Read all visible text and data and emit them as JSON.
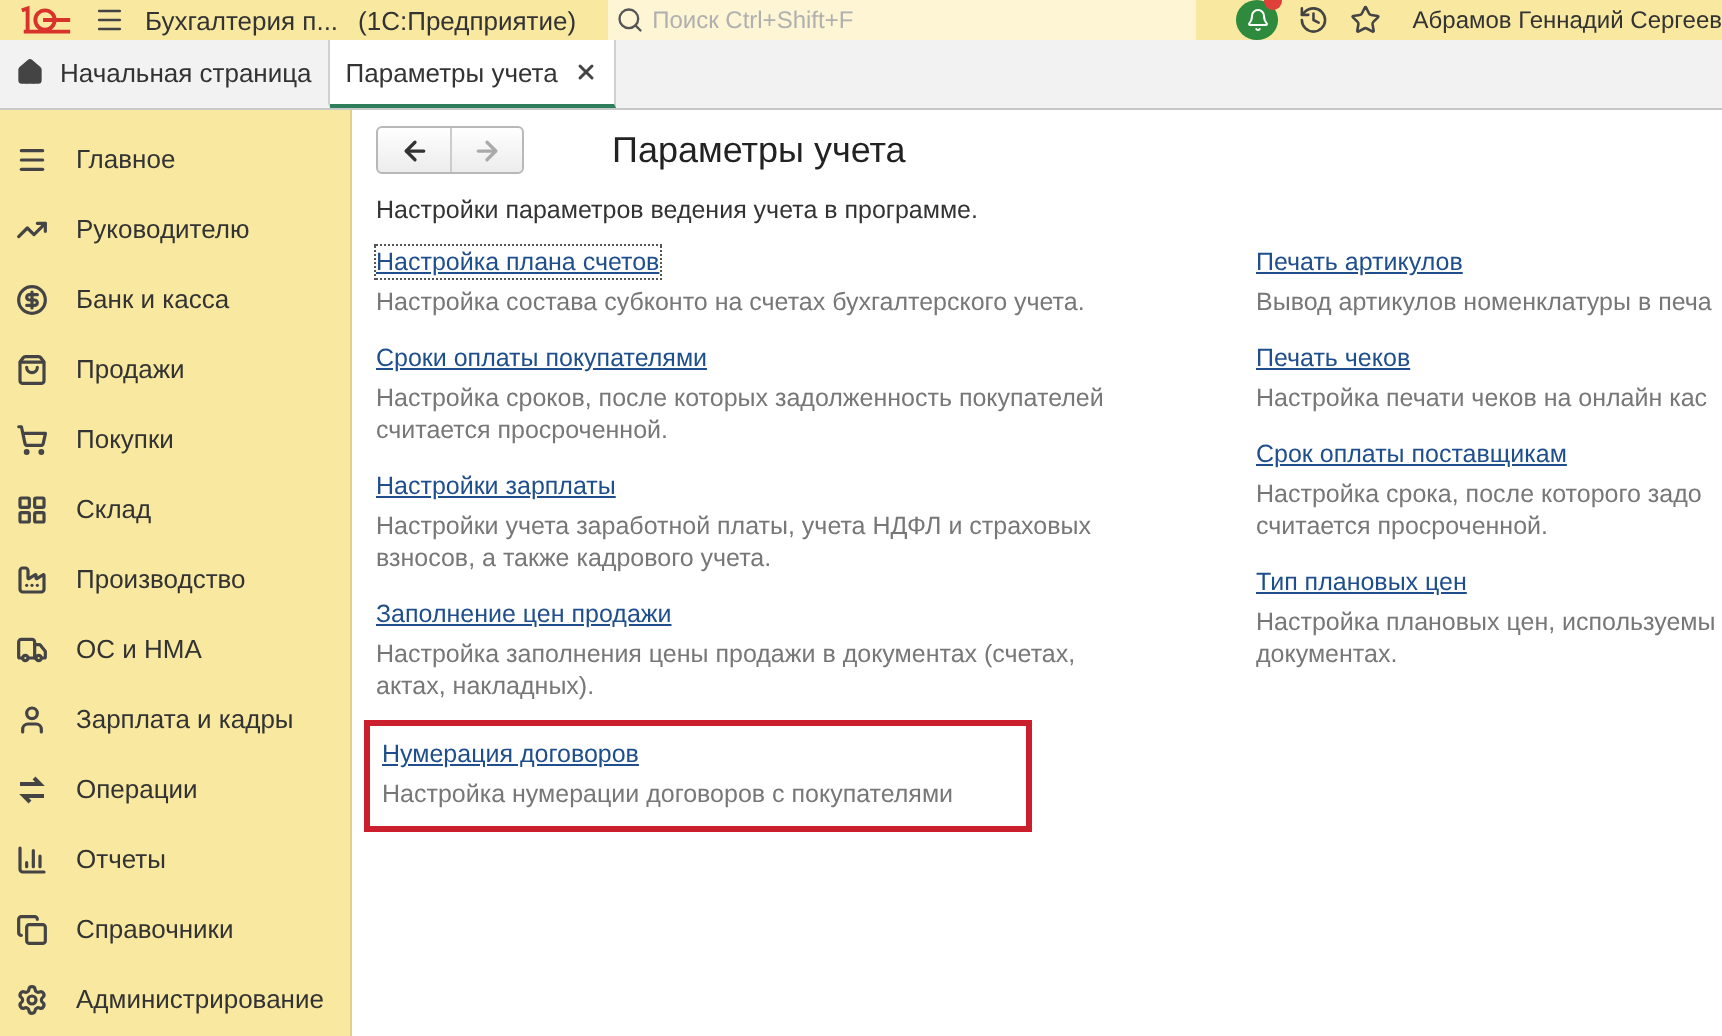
{
  "header": {
    "app_title": "Бухгалтерия п...",
    "app_subtitle": "(1С:Предприятие)",
    "search": {
      "placeholder": "Поиск Ctrl+Shift+F"
    },
    "user": "Абрамов Геннадий Сергеев"
  },
  "tabs": [
    {
      "label": "Начальная страница",
      "kind": "home",
      "selected": false
    },
    {
      "label": "Параметры учета",
      "kind": "document",
      "selected": true
    }
  ],
  "sidebar": {
    "items": [
      {
        "label": "Главное",
        "kind": "menu"
      },
      {
        "label": "Руководителю",
        "kind": "chart"
      },
      {
        "label": "Банк и касса",
        "kind": "ruble"
      },
      {
        "label": "Продажи",
        "kind": "bag"
      },
      {
        "label": "Покупки",
        "kind": "cart"
      },
      {
        "label": "Склад",
        "kind": "grid"
      },
      {
        "label": "Производство",
        "kind": "factory"
      },
      {
        "label": "ОС и НМА",
        "kind": "truck"
      },
      {
        "label": "Зарплата и кадры",
        "kind": "person"
      },
      {
        "label": "Операции",
        "kind": "dtkt"
      },
      {
        "label": "Отчеты",
        "kind": "bars"
      },
      {
        "label": "Справочники",
        "kind": "books"
      },
      {
        "label": "Администрирование",
        "kind": "gear"
      }
    ]
  },
  "page": {
    "title": "Параметры учета",
    "intro": "Настройки параметров ведения учета в программе.",
    "columns": [
      [
        {
          "link": "Настройка плана счетов",
          "lines": [
            "Настройка состава субконто на счетах бухгалтерского учета."
          ],
          "focused": true,
          "highlighted": false
        },
        {
          "link": "Сроки оплаты покупателями",
          "lines": [
            "Настройка сроков, после которых задолженность покупателей",
            "считается просроченной."
          ],
          "focused": false,
          "highlighted": false
        },
        {
          "link": "Настройки зарплаты",
          "lines": [
            "Настройки учета заработной платы, учета НДФЛ и страховых",
            "взносов, а также кадрового учета."
          ],
          "focused": false,
          "highlighted": false
        },
        {
          "link": "Заполнение цен продажи",
          "lines": [
            "Настройка заполнения цены продажи в документах (счетах,",
            "актах, накладных)."
          ],
          "focused": false,
          "highlighted": false
        },
        {
          "link": "Нумерация договоров",
          "lines": [
            "Настройка нумерации договоров с покупателями"
          ],
          "focused": false,
          "highlighted": true
        }
      ],
      [
        {
          "link": "Печать артикулов",
          "lines": [
            "Вывод артикулов номенклатуры в печа"
          ],
          "focused": false,
          "highlighted": false
        },
        {
          "link": "Печать чеков",
          "lines": [
            "Настройка печати чеков на онлайн кас"
          ],
          "focused": false,
          "highlighted": false
        },
        {
          "link": "Срок оплаты поставщикам",
          "lines": [
            "Настройка срока, после которого задо",
            "считается просроченной."
          ],
          "focused": false,
          "highlighted": false
        },
        {
          "link": "Тип плановых цен",
          "lines": [
            "Настройка плановых цен, используемы",
            "документах."
          ],
          "focused": false,
          "highlighted": false
        }
      ]
    ]
  }
}
